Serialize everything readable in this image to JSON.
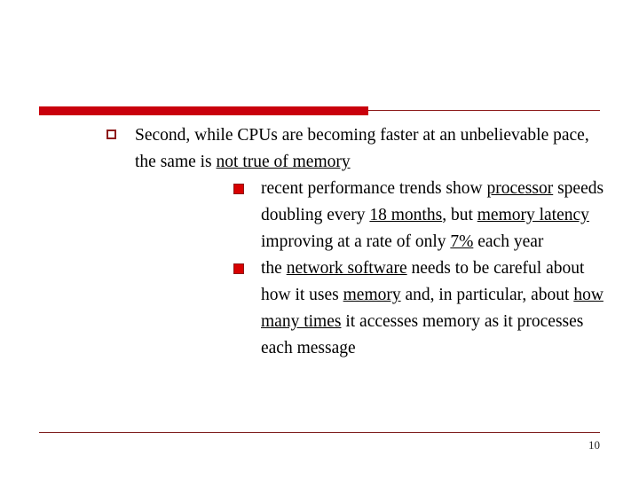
{
  "slide": {
    "theme": {
      "background": "#ffffff",
      "accent_bar": "#c9000c",
      "rule_line": "#8e1b1b",
      "text": "#000000",
      "bullet_level1": "#8e1b1b",
      "bullet_level2": "#d80000"
    },
    "bullets": [
      {
        "level": 1,
        "marker": "hollow-square-bullet",
        "runs": [
          {
            "text": "Second, while CPUs are becoming faster at an unbelievable pace, the same is ",
            "underline": false
          },
          {
            "text": "not true of memory",
            "underline": true
          }
        ]
      },
      {
        "level": 2,
        "marker": "filled-square-bullet",
        "runs": [
          {
            "text": "recent performance trends show ",
            "underline": false
          },
          {
            "text": "processor",
            "underline": true
          },
          {
            "text": " speeds doubling every ",
            "underline": false
          },
          {
            "text": "18 months",
            "underline": true
          },
          {
            "text": ", but ",
            "underline": false
          },
          {
            "text": "memory latency",
            "underline": true
          },
          {
            "text": " improving at a rate of only ",
            "underline": false
          },
          {
            "text": "7%",
            "underline": true
          },
          {
            "text": " each year",
            "underline": false
          }
        ]
      },
      {
        "level": 2,
        "marker": "filled-square-bullet",
        "runs": [
          {
            "text": "the ",
            "underline": false
          },
          {
            "text": "network software",
            "underline": true
          },
          {
            "text": " needs to be careful about how it uses ",
            "underline": false
          },
          {
            "text": "memory",
            "underline": true
          },
          {
            "text": " and, in particular, about ",
            "underline": false
          },
          {
            "text": "how many times",
            "underline": true
          },
          {
            "text": " it accesses memory as it processes each message",
            "underline": false
          }
        ]
      }
    ],
    "footer": {
      "slide_number": "10"
    }
  }
}
